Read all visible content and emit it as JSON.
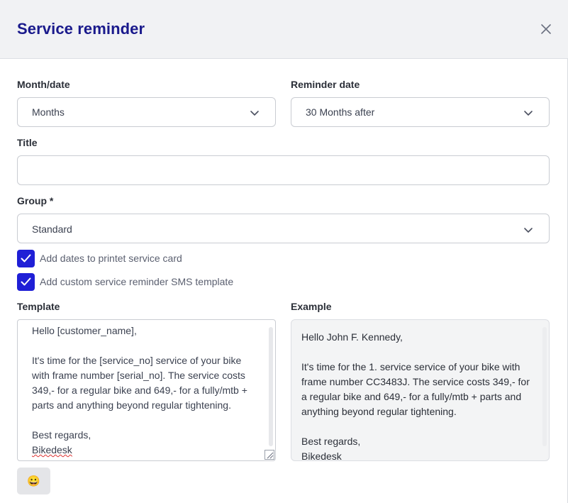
{
  "dialog": {
    "title": "Service reminder"
  },
  "fields": {
    "month_date": {
      "label": "Month/date",
      "value": "Months"
    },
    "reminder_date": {
      "label": "Reminder date",
      "value": "30 Months after"
    },
    "title": {
      "label": "Title",
      "value": ""
    },
    "group": {
      "label": "Group *",
      "value": "Standard"
    }
  },
  "checkboxes": {
    "add_dates": {
      "label": "Add dates to printet service card",
      "checked": true
    },
    "custom_sms": {
      "label": "Add custom service reminder SMS template",
      "checked": true
    }
  },
  "template": {
    "label": "Template",
    "value_line1": "Hello [customer_name],",
    "value_body": "It's time for the [service_no] service of your bike with frame number [serial_no]. The service costs 349,- for a regular bike and 649,- for a fully/mtb + parts and anything beyond regular tightening.",
    "value_closing": "Best regards,",
    "value_sign": "Bikedesk"
  },
  "example": {
    "label": "Example",
    "line1": "Hello John F. Kennedy,",
    "body": "It's time for the 1. service service of your bike with frame number CC3483J. The service costs 349,- for a regular bike and 649,- for a fully/mtb + parts and anything beyond regular tightening.",
    "closing": "Best regards,",
    "sign": "Bikedesk"
  },
  "emoji_button": {
    "icon": "😀"
  },
  "colors": {
    "accent": "#1f1fd6",
    "title": "#1a1a8c",
    "header_bg": "#f1f2f4"
  }
}
